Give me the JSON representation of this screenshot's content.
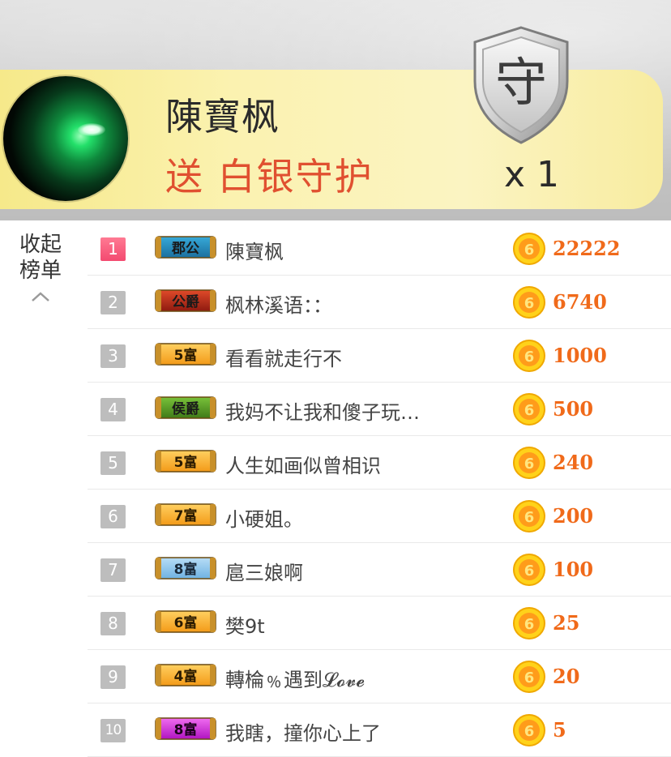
{
  "banner": {
    "sender": "陳寶枫",
    "gift_text": "送 白银守护",
    "shield_char": "守",
    "count": "x 1"
  },
  "collapse": {
    "line1": "收起",
    "line2": "榜单",
    "icon": "chevron-up-icon"
  },
  "ranking": [
    {
      "rank": "1",
      "badge": "郡公",
      "badge_theme": "gold-blue",
      "name": "陳寶枫",
      "amount": "22222"
    },
    {
      "rank": "2",
      "badge": "公爵",
      "badge_theme": "gold-red",
      "name": "枫林溪语：：",
      "amount": "6740"
    },
    {
      "rank": "3",
      "badge": "5富",
      "badge_theme": "orange",
      "name": "看看就走行不",
      "amount": "1000"
    },
    {
      "rank": "4",
      "badge": "侯爵",
      "badge_theme": "gold-green",
      "name": "我妈不让我和傻子玩…",
      "amount": "500"
    },
    {
      "rank": "5",
      "badge": "5富",
      "badge_theme": "orange",
      "name": "人生如画似曾相识",
      "amount": "240"
    },
    {
      "rank": "6",
      "badge": "7富",
      "badge_theme": "orange",
      "name": "小硬姐。",
      "amount": "200"
    },
    {
      "rank": "7",
      "badge": "8富",
      "badge_theme": "blue",
      "name": "扈三娘啊",
      "amount": "100"
    },
    {
      "rank": "8",
      "badge": "6富",
      "badge_theme": "orange",
      "name": "樊9t",
      "amount": "25"
    },
    {
      "rank": "9",
      "badge": "4富",
      "badge_theme": "orange",
      "name": "轉棆﹪遇到𝓛𝓸𝓿𝓮",
      "amount": "20"
    },
    {
      "rank": "10",
      "badge": "8富",
      "badge_theme": "purple",
      "name": "我瞎，撞你心上了",
      "amount": "5"
    }
  ],
  "colors": {
    "accent_amount": "#f06a1a",
    "gift_text": "#e05030",
    "rank_top": "#f34a70",
    "rank_other": "#bdbdbd",
    "banner_bar": "#fbf2b0"
  }
}
